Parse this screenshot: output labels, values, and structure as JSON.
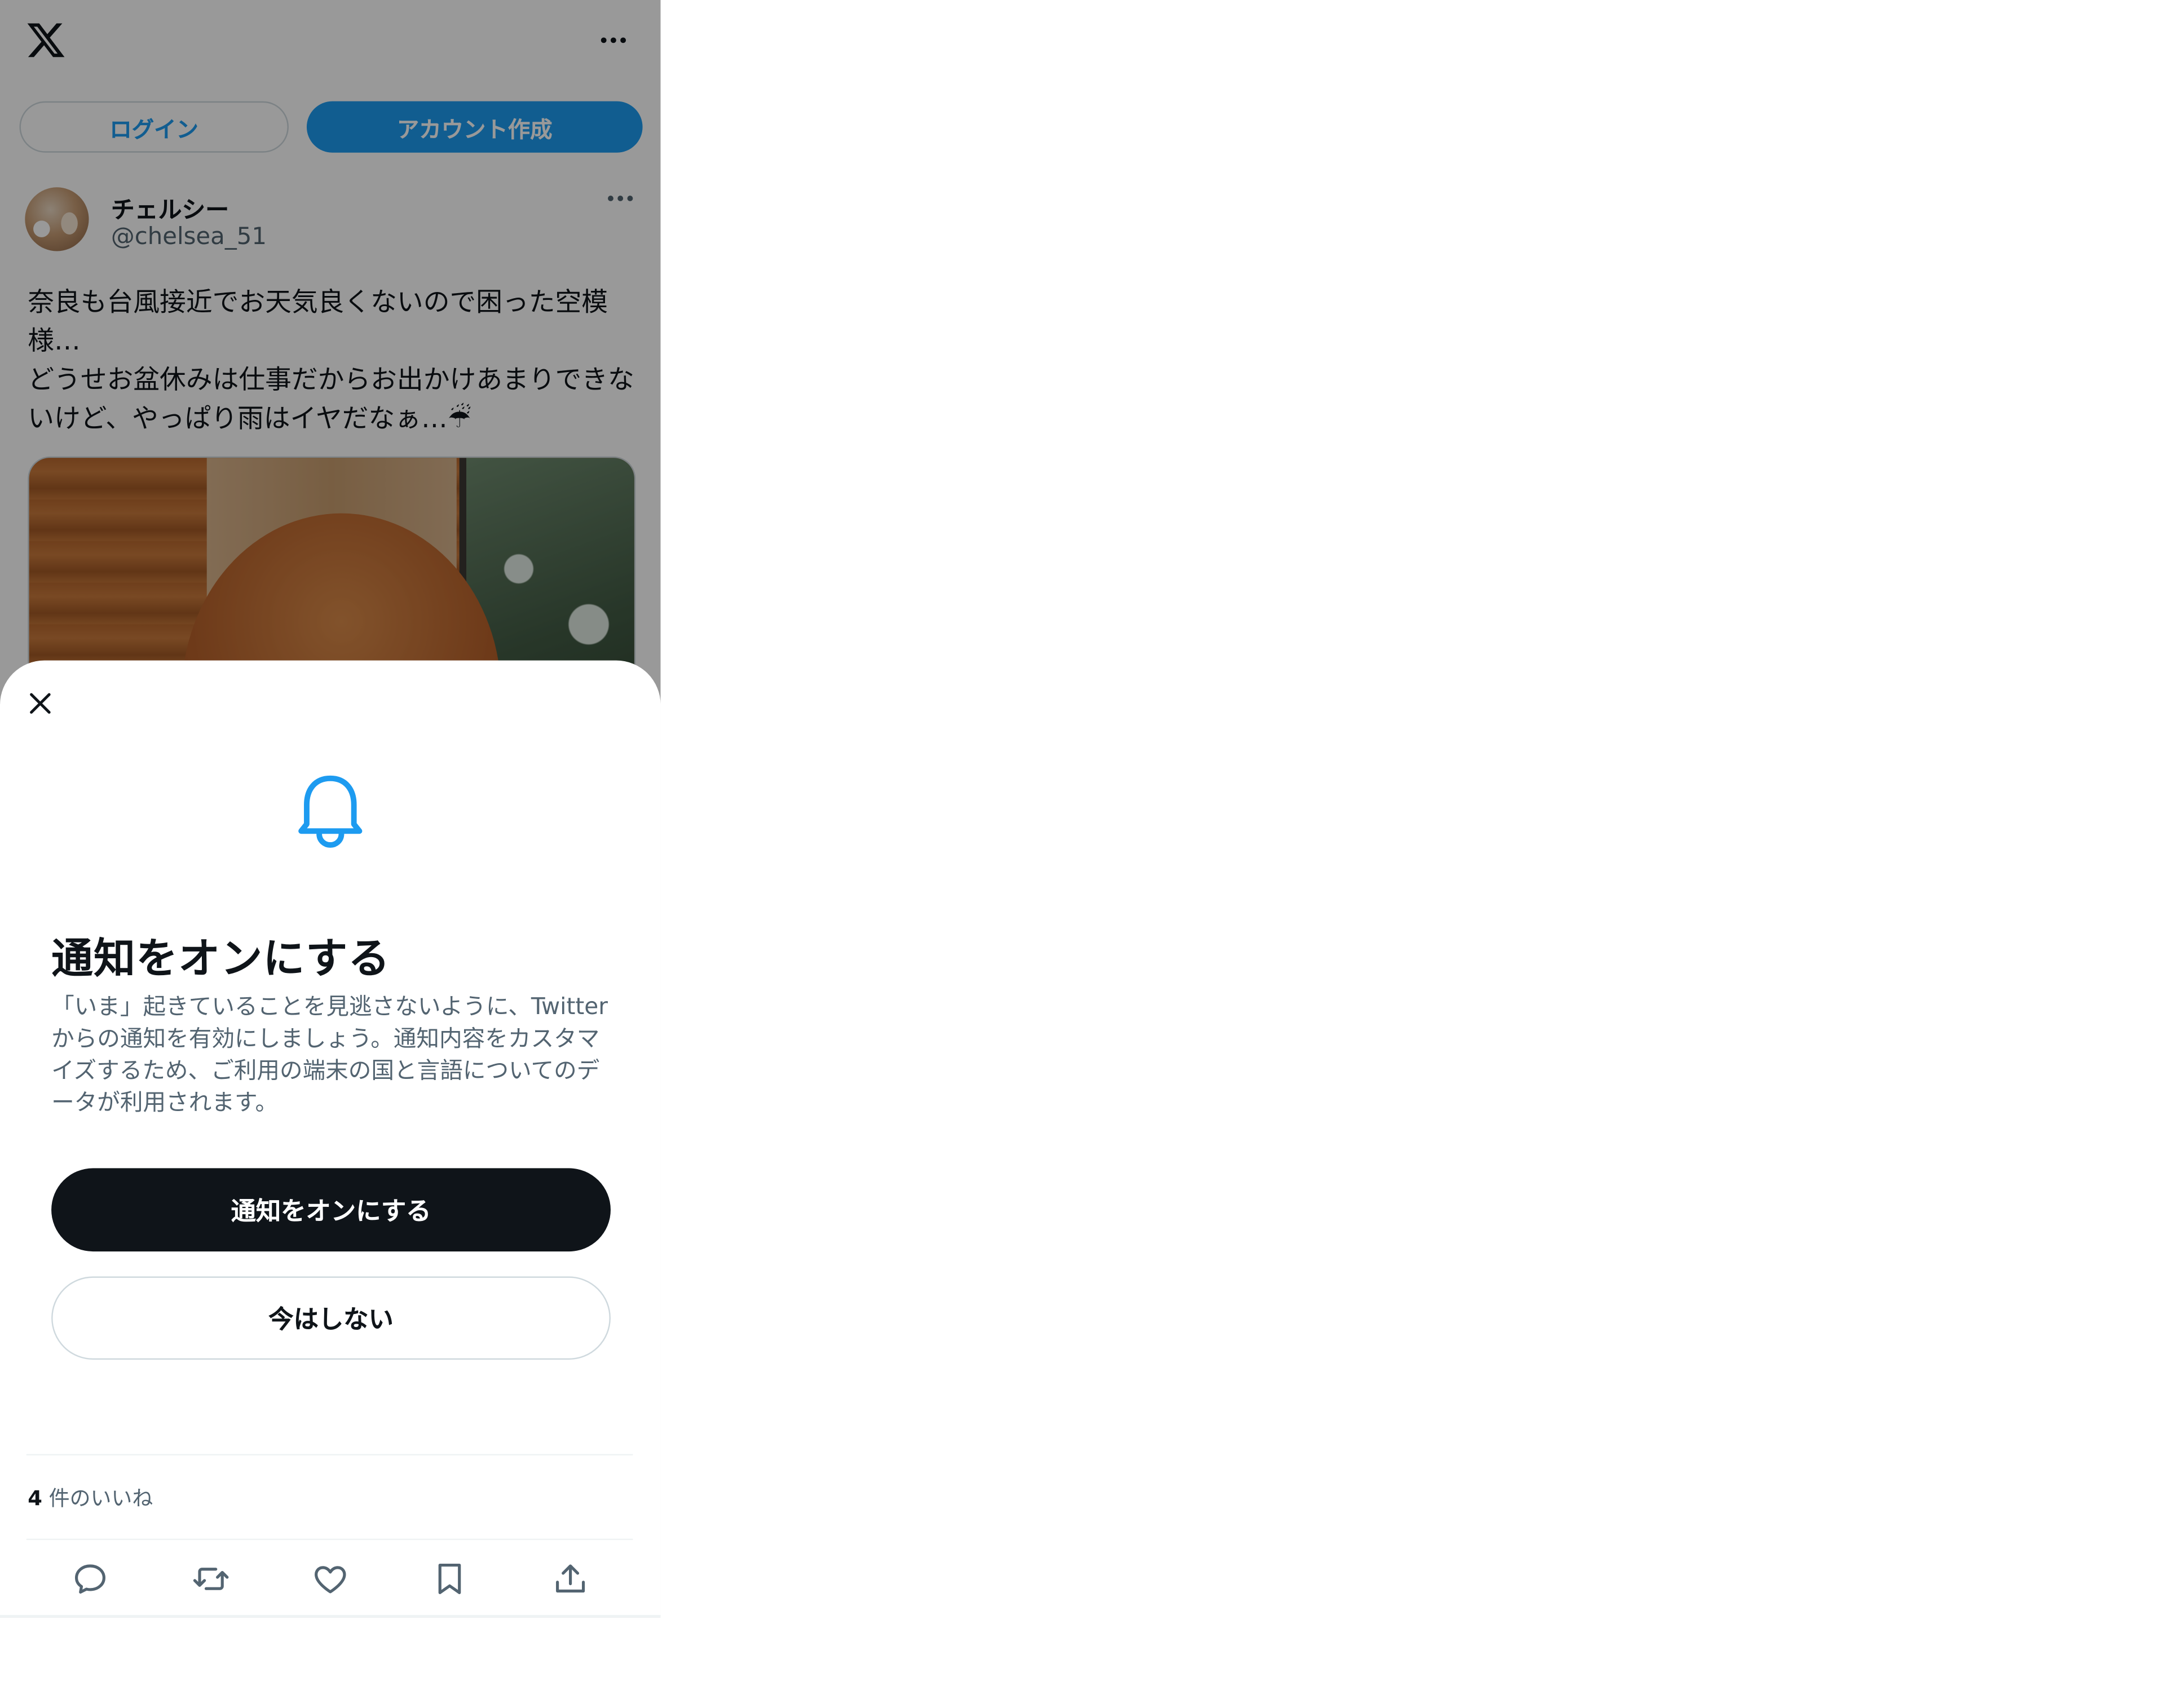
{
  "header": {
    "logo_icon": "x-logo-icon",
    "more_icon": "more-horizontal-icon"
  },
  "auth": {
    "login_label": "ログイン",
    "signup_label": "アカウント作成"
  },
  "tweet": {
    "author_name": "チェルシー",
    "author_handle": "@chelsea_51",
    "text": "奈良も台風接近でお天気良くないので困った空模様…\nどうせお盆休みは仕事だからお出かけあまりできないけど、やっぱり雨はイヤだなぁ…☔",
    "likes_count": "4",
    "likes_label": " 件のいいね",
    "actions": [
      "reply-icon",
      "retweet-icon",
      "like-icon",
      "bookmark-icon",
      "share-icon"
    ]
  },
  "notification_sheet": {
    "title": "通知をオンにする",
    "description": "「いま」起きていることを見逃さないように、Twitterからの通知を有効にしましょう。通知内容をカスタマイズするため、ご利用の端末の国と言語についてのデータが利用されます。",
    "enable_button_label": "通知をオンにする",
    "later_button_label": "今はしない",
    "icon": "bell-icon"
  },
  "colors": {
    "accent": "#1d9bf0",
    "primary_text": "#0f1419",
    "secondary_text": "#536471",
    "border": "#cfd9de"
  }
}
